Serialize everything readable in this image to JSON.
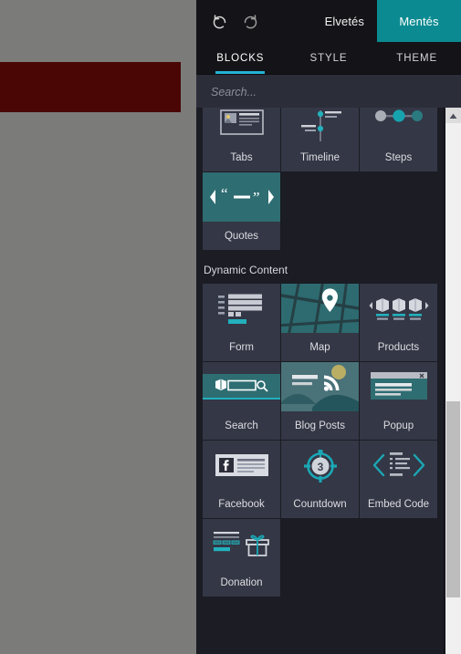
{
  "canvas": {
    "background_color": "#7b7b79",
    "band_color": "#4a0505",
    "band_name": "page-section-band"
  },
  "topbar": {
    "undo_icon": "undo-arrow-icon",
    "redo_icon": "redo-arrow-icon",
    "discard_label": "Elvetés",
    "save_label": "Mentés",
    "save_color": "#0b8b91"
  },
  "tabs": [
    {
      "label": "BLOCKS",
      "active": true
    },
    {
      "label": "STYLE",
      "active": false
    },
    {
      "label": "THEME",
      "active": false
    }
  ],
  "search": {
    "placeholder": "Search...",
    "value": "",
    "icon": "search-icon"
  },
  "blocks": {
    "clipped_row": [
      {
        "label": "Tabs",
        "icon": "tabs-thumbnail-icon"
      },
      {
        "label": "Timeline",
        "icon": "timeline-thumbnail-icon"
      },
      {
        "label": "Steps",
        "icon": "steps-thumbnail-icon"
      }
    ],
    "quotes_row": [
      {
        "label": "Quotes",
        "icon": "quotes-carousel-thumbnail-icon"
      }
    ],
    "dynamic_content": {
      "title": "Dynamic Content",
      "items": [
        {
          "label": "Form",
          "icon": "form-thumbnail-icon"
        },
        {
          "label": "Map",
          "icon": "map-thumbnail-icon"
        },
        {
          "label": "Products",
          "icon": "products-thumbnail-icon"
        },
        {
          "label": "Search",
          "icon": "search-block-thumbnail-icon"
        },
        {
          "label": "Blog Posts",
          "icon": "blog-posts-thumbnail-icon"
        },
        {
          "label": "Popup",
          "icon": "popup-thumbnail-icon"
        },
        {
          "label": "Facebook",
          "icon": "facebook-thumbnail-icon"
        },
        {
          "label": "Countdown",
          "icon": "countdown-thumbnail-icon"
        },
        {
          "label": "Embed Code",
          "icon": "embed-code-thumbnail-icon"
        },
        {
          "label": "Donation",
          "icon": "donation-thumbnail-icon"
        }
      ]
    }
  },
  "scrollbar": {
    "up_arrow_icon": "scroll-up-arrow-icon",
    "thumb_name": "scroll-thumb"
  },
  "theme": {
    "panel_bg": "#1b1c24",
    "tile_bg": "#343745",
    "accent_teal": "#23b0bd",
    "tab_underline": "#24b3d4"
  }
}
